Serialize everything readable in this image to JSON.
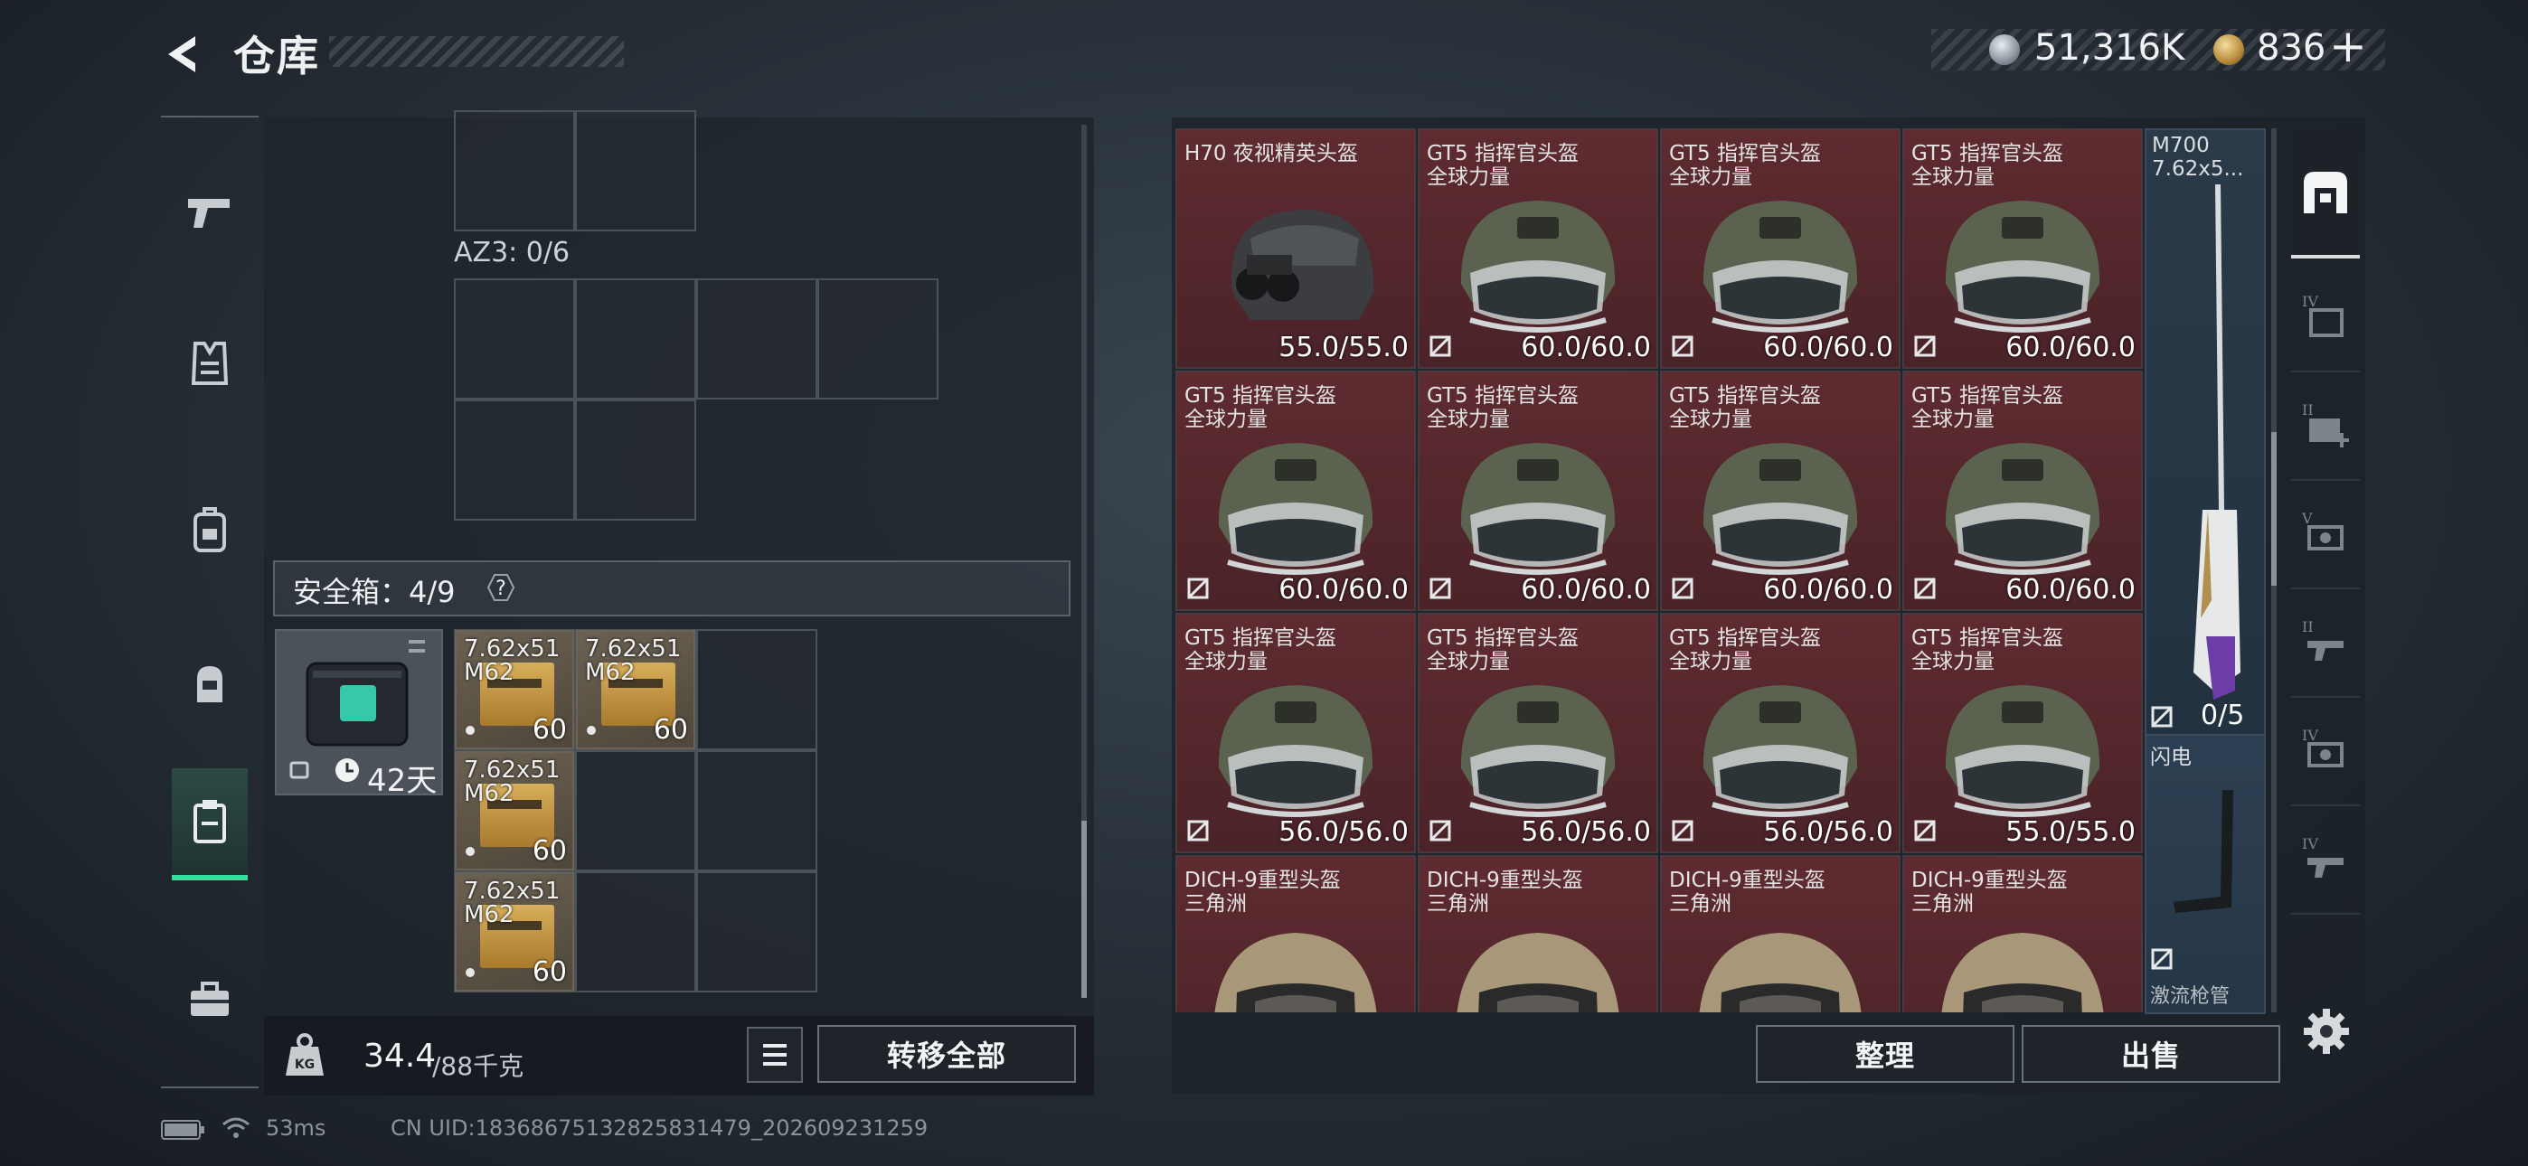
{
  "header": {
    "title": "仓库"
  },
  "currency": {
    "silver": "51,316K",
    "gold": "836",
    "gold_add": "+"
  },
  "left_nav": [
    "weapon",
    "armor-vest",
    "backpack",
    "helmet",
    "container",
    "toolbox"
  ],
  "stash": {
    "az3_label": "AZ3: 0/6",
    "safebox_label": "安全箱：4/9",
    "help": "?",
    "safebox_days": "42天",
    "ammo": [
      {
        "n1": "7.62x51",
        "n2": "M62",
        "count": "60"
      },
      {
        "n1": "7.62x51",
        "n2": "M62",
        "count": "60"
      },
      {
        "n1": "7.62x51",
        "n2": "M62",
        "count": "60"
      },
      {
        "n1": "7.62x51",
        "n2": "M62",
        "count": "60"
      }
    ],
    "weight_value": "34.4",
    "weight_max": "/88千克",
    "transfer_all": "转移全部"
  },
  "warehouse": {
    "items": [
      {
        "n1": "H70 夜视精英头盔",
        "n2": "",
        "dur": "55.0/55.0",
        "type": "nv"
      },
      {
        "n1": "GT5 指挥官头盔",
        "n2": "全球力量",
        "dur": "60.0/60.0",
        "type": "gt5"
      },
      {
        "n1": "GT5 指挥官头盔",
        "n2": "全球力量",
        "dur": "60.0/60.0",
        "type": "gt5"
      },
      {
        "n1": "GT5 指挥官头盔",
        "n2": "全球力量",
        "dur": "60.0/60.0",
        "type": "gt5"
      },
      {
        "n1": "GT5 指挥官头盔",
        "n2": "全球力量",
        "dur": "60.0/60.0",
        "type": "gt5"
      },
      {
        "n1": "GT5 指挥官头盔",
        "n2": "全球力量",
        "dur": "60.0/60.0",
        "type": "gt5"
      },
      {
        "n1": "GT5 指挥官头盔",
        "n2": "全球力量",
        "dur": "60.0/60.0",
        "type": "gt5"
      },
      {
        "n1": "GT5 指挥官头盔",
        "n2": "全球力量",
        "dur": "60.0/60.0",
        "type": "gt5"
      },
      {
        "n1": "GT5 指挥官头盔",
        "n2": "全球力量",
        "dur": "56.0/56.0",
        "type": "gt5"
      },
      {
        "n1": "GT5 指挥官头盔",
        "n2": "全球力量",
        "dur": "56.0/56.0",
        "type": "gt5"
      },
      {
        "n1": "GT5 指挥官头盔",
        "n2": "全球力量",
        "dur": "56.0/56.0",
        "type": "gt5"
      },
      {
        "n1": "GT5 指挥官头盔",
        "n2": "全球力量",
        "dur": "55.0/55.0",
        "type": "gt5"
      },
      {
        "n1": "DICH-9重型头盔",
        "n2": "三角洲",
        "dur": "",
        "type": "dich"
      },
      {
        "n1": "DICH-9重型头盔",
        "n2": "三角洲",
        "dur": "",
        "type": "dich"
      },
      {
        "n1": "DICH-9重型头盔",
        "n2": "三角洲",
        "dur": "",
        "type": "dich"
      },
      {
        "n1": "DICH-9重型头盔",
        "n2": "三角洲",
        "dur": "",
        "type": "dich"
      }
    ],
    "side_weapon": {
      "n1": "M700",
      "n2": "7.62x5...",
      "count": "0/5"
    },
    "side_part": {
      "name": "闪电",
      "sub": "激流枪管"
    },
    "sort": "整理",
    "sell": "出售"
  },
  "categories": [
    "all",
    "iv-container",
    "ii-medkit",
    "v-equipment",
    "ii-gun",
    "iv-equipment",
    "iv-gun"
  ],
  "footer": {
    "ping": "53ms",
    "uid": "CN UID:1836867513282583147​9_202609231259"
  },
  "colors": {
    "accent": "#3ddc9a",
    "item_bg": "#5e2b30",
    "panel_bg": "#1e242a"
  }
}
